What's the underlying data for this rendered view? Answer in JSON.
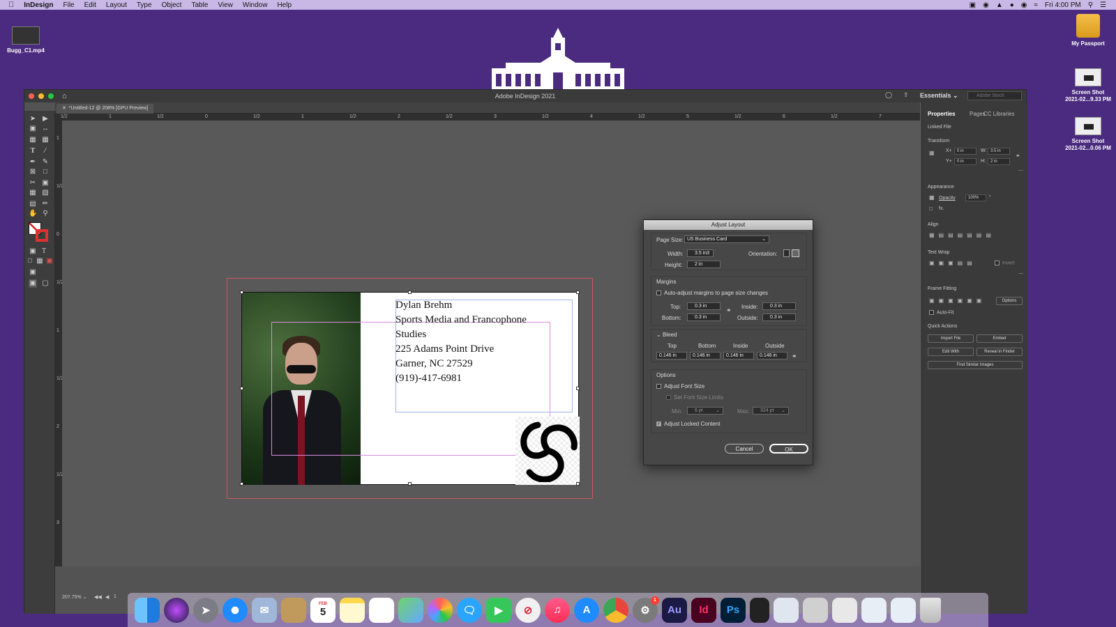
{
  "menubar": {
    "app": "InDesign",
    "items": [
      "File",
      "Edit",
      "Layout",
      "Type",
      "Object",
      "Table",
      "View",
      "Window",
      "Help"
    ],
    "clock": "Fri 4:00 PM"
  },
  "desktop": {
    "video": "Bugg_C1.mp4",
    "drive": "My Passport",
    "shot1_a": "Screen Shot",
    "shot1_b": "2021-02...9.33 PM",
    "shot2_a": "Screen Shot",
    "shot2_b": "2021-02...0.06 PM"
  },
  "window": {
    "title": "Adobe InDesign 2021",
    "workspace": "Essentials",
    "stock_placeholder": "Adobe Stock",
    "doc_tab": "*Untitled-12 @ 208% [GPU Preview]",
    "zoom": "207.75%",
    "page_num": "1"
  },
  "ruler": {
    "h": [
      "1/2",
      "1",
      "1/2",
      "0",
      "1/2",
      "1",
      "1/2",
      "2",
      "1/2",
      "3",
      "1/2",
      "4",
      "1/2",
      "5",
      "1/2",
      "6",
      "1/2",
      "7"
    ],
    "v": [
      "1",
      "1/2",
      "0",
      "1/2",
      "1",
      "1/2",
      "2",
      "1/2",
      "3"
    ]
  },
  "card": {
    "lines": [
      "Dylan Brehm",
      "Sports Media and Francophone",
      "Studies",
      "225 Adams Point Drive",
      "Garner, NC 27529",
      "(919)-417-6981"
    ]
  },
  "panel": {
    "tabs": [
      "Properties",
      "Pages",
      "CC Libraries"
    ],
    "linked_file": "Linked File",
    "transform": "Transform",
    "x_label": "X+",
    "x_val": "0 in",
    "y_label": "Y+",
    "y_val": "0 in",
    "w_label": "W:",
    "w_val": "3.5 in",
    "h_label": "H:",
    "h_val": "2 in",
    "appearance": "Appearance",
    "opacity_label": "Opacity",
    "opacity_val": "100%",
    "fx": "fx.",
    "align": "Align",
    "text_wrap": "Text Wrap",
    "invert": "Invert",
    "frame_fitting": "Frame Fitting",
    "options": "Options",
    "auto_fit": "Auto-Fit",
    "quick_actions": "Quick Actions",
    "import_file": "Import File",
    "embed": "Embed",
    "edit_with": "Edit With",
    "reveal": "Reveal in Finder",
    "find_similar": "Find Similar Images"
  },
  "dialog": {
    "title": "Adjust Layout",
    "page_size_label": "Page Size:",
    "page_size_val": "US Business Card",
    "width_label": "Width:",
    "width_val": "3.5 in3",
    "height_label": "Height:",
    "height_val": "2 in",
    "orientation_label": "Orientation:",
    "margins_title": "Margins",
    "auto_adjust": "Auto-adjust margins to page size changes",
    "top_label": "Top:",
    "top_val": "0.3 in",
    "bottom_label": "Bottom:",
    "bottom_val": "0.3 in",
    "inside_label": "Inside:",
    "inside_val": "0.3 in",
    "outside_label": "Outside:",
    "outside_val": "0.3 in",
    "bleed_title": "Bleed",
    "bleed_cols": [
      "Top",
      "Bottom",
      "Inside",
      "Outside"
    ],
    "bleed_vals": [
      "0.146 in",
      "0.146 in",
      "0.146 in",
      "0.146 in"
    ],
    "options_title": "Options",
    "adjust_font": "Adjust Font Size",
    "set_limits": "Set Font Size Limits",
    "min_label": "Min:",
    "min_val": "6 pt",
    "max_label": "Max:",
    "max_val": "324 pt",
    "adjust_locked": "Adjust Locked Content",
    "cancel": "Cancel",
    "ok": "OK"
  },
  "dock": {
    "au": "Au",
    "id": "Id",
    "ps": "Ps",
    "calendar_month": "FEB",
    "calendar_day": "5",
    "badge": "1"
  }
}
